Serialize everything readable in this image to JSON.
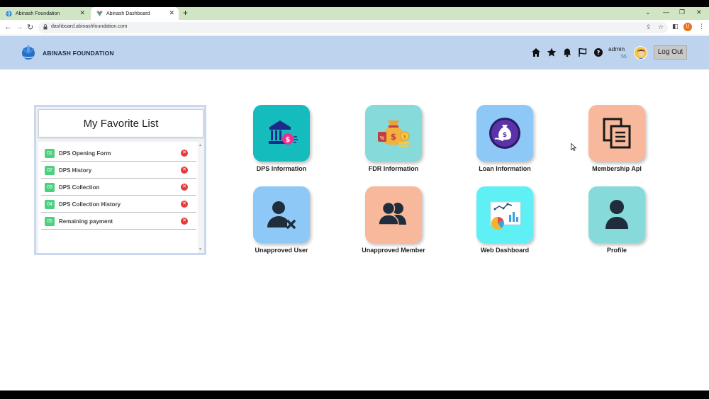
{
  "browser": {
    "tabs": [
      {
        "title": "Abinash Foundation",
        "active": false
      },
      {
        "title": "Abinash Dashboard",
        "active": true
      }
    ],
    "url": "dashboard.abinashfoundation.com",
    "profile_initial": "U"
  },
  "header": {
    "brand": "ABINASH FOUNDATION",
    "icons": [
      "home-icon",
      "star-icon",
      "bell-icon",
      "flag-icon",
      "help-icon"
    ],
    "user_name": "admin",
    "user_count": "55",
    "logout_label": "Log Out",
    "bg_color": "#bdd3ee"
  },
  "favorites": {
    "title": "My Favorite List",
    "items": [
      {
        "num": "01",
        "label": "DPS Opening Form"
      },
      {
        "num": "02",
        "label": "DPS History"
      },
      {
        "num": "03",
        "label": "DPS Collection"
      },
      {
        "num": "04",
        "label": "DPS Collection History"
      },
      {
        "num": "05",
        "label": "Remaining payment"
      }
    ]
  },
  "tiles": [
    {
      "label": "DPS Information",
      "color": "#15bcbd",
      "icon": "bank-dollar-icon"
    },
    {
      "label": "FDR Information",
      "color": "#86dada",
      "icon": "money-bag-icon"
    },
    {
      "label": "Loan Information",
      "color": "#8ec8f6",
      "icon": "loan-bag-icon"
    },
    {
      "label": "Membership Apl",
      "color": "#f7b89b",
      "icon": "documents-icon"
    },
    {
      "label": "Unapproved User",
      "color": "#8ec8f6",
      "icon": "user-remove-icon"
    },
    {
      "label": "Unapproved Member",
      "color": "#f7b89b",
      "icon": "users-icon"
    },
    {
      "label": "Web Dashboard",
      "color": "#5ef0f4",
      "icon": "dashboard-chart-icon"
    },
    {
      "label": "Profile",
      "color": "#86dada",
      "icon": "user-icon"
    }
  ]
}
